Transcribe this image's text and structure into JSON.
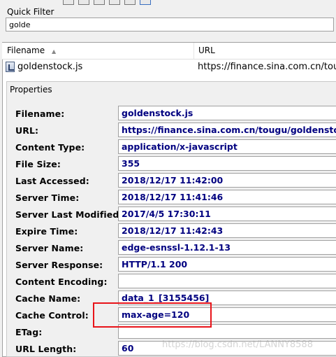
{
  "quick_filter": {
    "label": "Quick Filter",
    "value": "golde"
  },
  "file_list": {
    "columns": [
      "Filename",
      "URL"
    ],
    "rows": [
      {
        "filename": "goldenstock.js",
        "url": "https://finance.sina.com.cn/tougu"
      }
    ]
  },
  "properties": {
    "title": "Properties",
    "fields": [
      {
        "label": "Filename:",
        "value": "goldenstock.js"
      },
      {
        "label": "URL:",
        "value": "https://finance.sina.com.cn/tougu/goldenstock/"
      },
      {
        "label": "Content Type:",
        "value": "application/x-javascript"
      },
      {
        "label": "File Size:",
        "value": "355"
      },
      {
        "label": "Last Accessed:",
        "value": "2018/12/17 11:42:00"
      },
      {
        "label": "Server Time:",
        "value": "2018/12/17 11:41:46"
      },
      {
        "label": "Server Last Modified:",
        "value": "2017/4/5 17:30:11"
      },
      {
        "label": "Expire Time:",
        "value": "2018/12/17 11:42:43"
      },
      {
        "label": "Server Name:",
        "value": "edge-esnssl-1.12.1-13"
      },
      {
        "label": "Server Response:",
        "value": "HTTP/1.1 200"
      },
      {
        "label": "Content Encoding:",
        "value": ""
      },
      {
        "label": "Cache Name:",
        "value": "data_1_[3155456]"
      },
      {
        "label": "Cache Control:",
        "value": "max-age=120"
      },
      {
        "label": "ETag:",
        "value": ""
      },
      {
        "label": "URL Length:",
        "value": "60"
      }
    ]
  },
  "watermark": "https://blog.csdn.net/LANNY8588",
  "colors": {
    "value_text": "#000080",
    "highlight": "#e8141a",
    "window_bg": "#f0f0f0"
  }
}
